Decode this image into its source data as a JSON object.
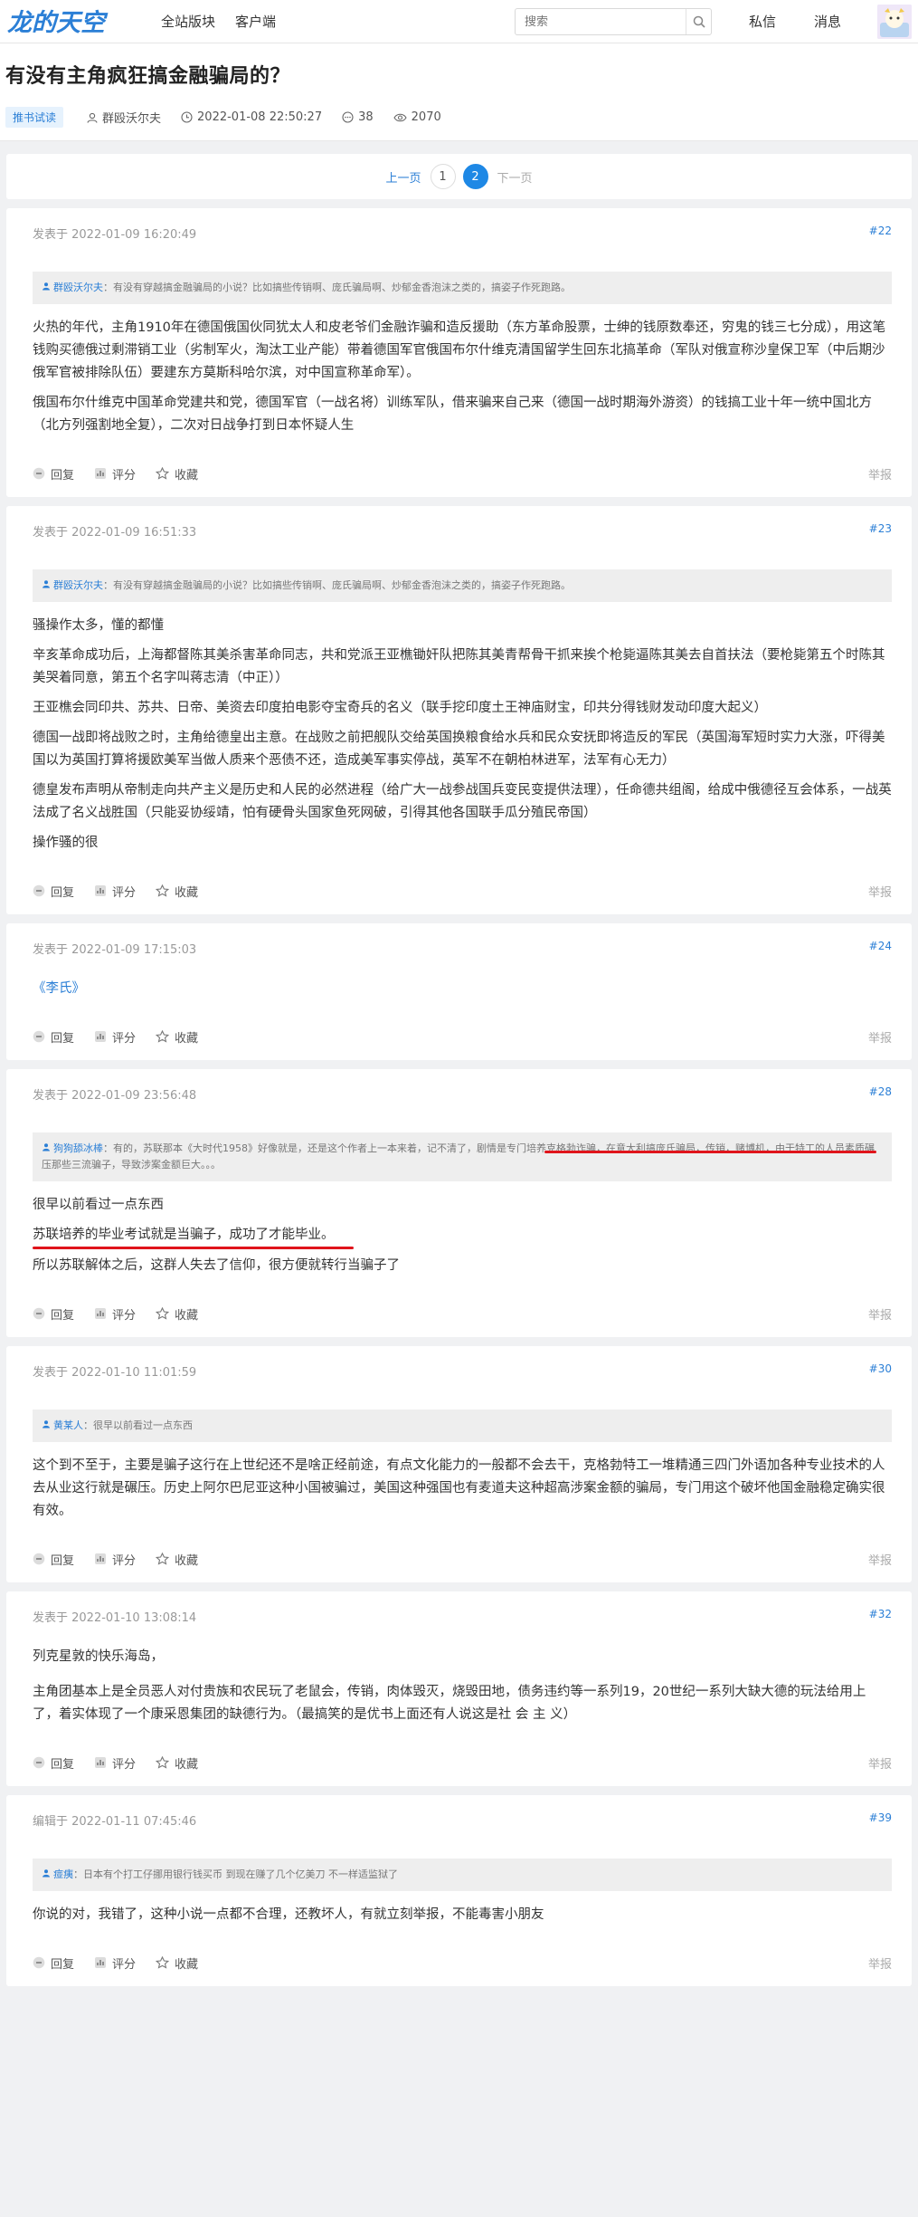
{
  "header": {
    "logo_text": "龙的天空",
    "nav": [
      "全站版块",
      "客户端"
    ],
    "search_placeholder": "搜索",
    "messages": "私信",
    "notifications": "消息"
  },
  "thread": {
    "title": "有没有主角疯狂搞金融骗局的？",
    "tag": "推书试读",
    "author": "群殴沃尔夫",
    "datetime": "2022-01-08 22:50:27",
    "replies": "38",
    "views": "2070"
  },
  "pager": {
    "prev": "上一页",
    "pages": [
      "1",
      "2"
    ],
    "current": "2",
    "next": "下一页"
  },
  "actions": {
    "reply": "回复",
    "rate": "评分",
    "fav": "收藏",
    "report": "举报"
  },
  "posts": [
    {
      "date": "发表于 2022-01-09 16:20:49",
      "floor": "#22",
      "quote_author": "群殴沃尔夫",
      "quote_text": "：有没有穿越搞金融骗局的小说？比如搞些传销啊、庞氏骗局啊、炒郁金香泡沫之类的，搞姿子作死跑路。",
      "paragraphs": [
        "火热的年代，主角1910年在德国俄国伙同犹太人和皮老爷们金融诈骗和造反援助（东方革命股票，士绅的钱原数奉还，穷鬼的钱三七分成），用这笔钱购买德俄过剩滞销工业（劣制军火，淘汰工业产能）带着德国军官俄国布尔什维克清国留学生回东北搞革命（军队对俄宣称沙皇保卫军（中后期沙俄军官被排除队伍）要建东方莫斯科哈尔滨，对中国宣称革命军）。",
        "俄国布尔什维克中国革命党建共和党，德国军官（一战名将）训练军队，借来骗来自己来（德国一战时期海外游资）的钱搞工业十年一统中国北方（北方列强割地全复），二次对日战争打到日本怀疑人生"
      ]
    },
    {
      "date": "发表于 2022-01-09 16:51:33",
      "floor": "#23",
      "quote_author": "群殴沃尔夫",
      "quote_text": "：有没有穿越搞金融骗局的小说？比如搞些传销啊、庞氏骗局啊、炒郁金香泡沫之类的，搞姿子作死跑路。",
      "paragraphs": [
        "骚操作太多，懂的都懂",
        "辛亥革命成功后，上海都督陈其美杀害革命同志，共和党派王亚樵锄奸队把陈其美青帮骨干抓来挨个枪毙逼陈其美去自首扶法（要枪毙第五个时陈其美哭着同意，第五个名字叫蒋志清（中正））",
        "王亚樵会同印共、苏共、日帝、美资去印度拍电影夺宝奇兵的名义（联手挖印度土王神庙财宝，印共分得钱财发动印度大起义）",
        "德国一战即将战败之时，主角给德皇出主意。在战败之前把舰队交给英国换粮食给水兵和民众安抚即将造反的军民（英国海军短时实力大涨，吓得美国以为英国打算将援欧美军当做人质来个恶债不还，造成美军事实停战，英军不在朝柏林进军，法军有心无力）",
        "德皇发布声明从帝制走向共产主义是历史和人民的必然进程（给广大一战参战国兵变民变提供法理），任命德共组阁，给成中俄德径互会体系，一战英法成了名义战胜国（只能妥协绥靖，怕有硬骨头国家鱼死网破，引得其他各国联手瓜分殖民帝国）",
        "操作骚的很"
      ]
    },
    {
      "date": "发表于 2022-01-09 17:15:03",
      "floor": "#24",
      "link_text": "《李氏》",
      "paragraphs": []
    },
    {
      "date": "发表于 2022-01-09 23:56:48",
      "floor": "#28",
      "quote_author": "狗狗舔冰棒",
      "quote_text": "：有的，苏联那本《大时代1958》好像就是，还是这个作者上一本来着，记不清了，剧情是专门培养克格勃诈骗，在意大利搞庞氏骗局，传销，赌博机，由于特工的人员素质碾压那些三流骗子，导致涉案金额巨大。。。",
      "paragraphs": [
        "很早以前看过一点东西",
        "苏联培养的毕业考试就是当骗子，成功了才能毕业。",
        "所以苏联解体之后，这群人失去了信仰，很方便就转行当骗子了"
      ]
    },
    {
      "date": "发表于 2022-01-10 11:01:59",
      "floor": "#30",
      "quote_author": "黄某人",
      "quote_text": "：很早以前看过一点东西",
      "paragraphs": [
        "这个到不至于，主要是骗子这行在上世纪还不是啥正经前途，有点文化能力的一般都不会去干，克格勃特工一堆精通三四门外语加各种专业技术的人去从业这行就是碾压。历史上阿尔巴尼亚这种小国被骗过，美国这种强国也有麦道夫这种超高涉案金额的骗局，专门用这个破坏他国金融稳定确实很有效。"
      ]
    },
    {
      "date": "发表于 2022-01-10 13:08:14",
      "floor": "#32",
      "paragraphs": [
        "列克星敦的快乐海岛，",
        "主角团基本上是全员恶人对付贵族和农民玩了老鼠会，传销，肉体毁灭，烧毁田地，债务违约等一系列19，20世纪一系列大缺大德的玩法给用上了，着实体现了一个康采恩集团的缺德行为。（最搞笑的是优书上面还有人说这是社 会 主 义）"
      ]
    },
    {
      "date": "编辑于 2022-01-11 07:45:46",
      "floor": "#39",
      "quote_author": "痖痍",
      "quote_text": "：日本有个打工仔挪用银行钱买币 到现在赚了几个亿美刀 不一样适监狱了",
      "paragraphs": [
        "你说的对，我错了，这种小说一点都不合理，还教坏人，有就立刻举报，不能毒害小朋友"
      ]
    }
  ]
}
